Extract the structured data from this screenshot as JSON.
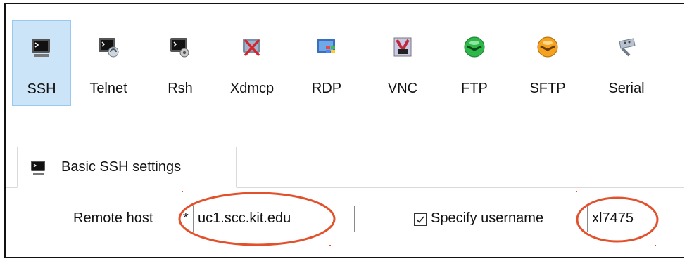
{
  "toolbar": {
    "items": [
      {
        "label": "SSH",
        "icon": "ssh-terminal-icon",
        "selected": true
      },
      {
        "label": "Telnet",
        "icon": "telnet-icon",
        "selected": false
      },
      {
        "label": "Rsh",
        "icon": "rsh-icon",
        "selected": false
      },
      {
        "label": "Xdmcp",
        "icon": "xdmcp-icon",
        "selected": false
      },
      {
        "label": "RDP",
        "icon": "rdp-icon",
        "selected": false
      },
      {
        "label": "VNC",
        "icon": "vnc-icon",
        "selected": false
      },
      {
        "label": "FTP",
        "icon": "ftp-icon",
        "selected": false
      },
      {
        "label": "SFTP",
        "icon": "sftp-icon",
        "selected": false
      },
      {
        "label": "Serial",
        "icon": "serial-icon",
        "selected": false
      }
    ]
  },
  "settings_tab": {
    "label": "Basic SSH settings",
    "icon": "ssh-terminal-icon"
  },
  "remote_host": {
    "label": "Remote host",
    "required_mark": "*",
    "value": "uc1.scc.kit.edu"
  },
  "username": {
    "checkbox_checked": true,
    "label": "Specify username",
    "value": "xl7475"
  },
  "colors": {
    "selected_bg": "#cce4f7",
    "annotation": "#e2512c"
  }
}
